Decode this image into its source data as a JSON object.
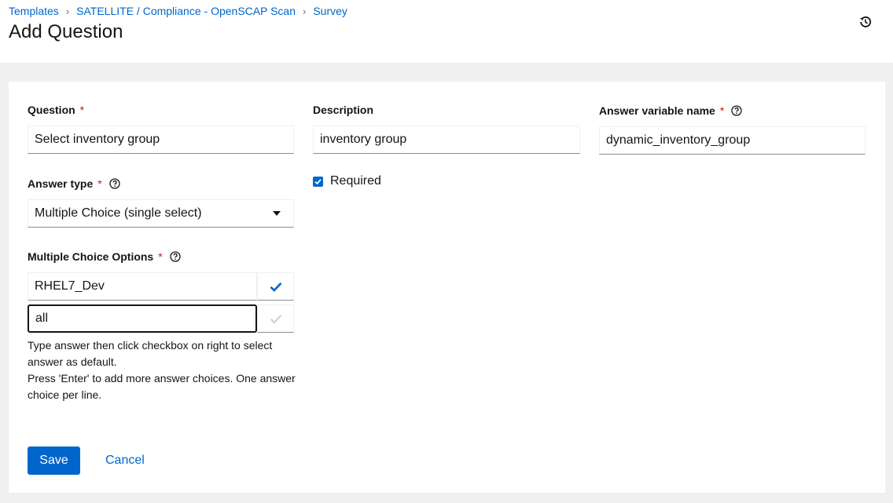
{
  "breadcrumb": {
    "items": [
      "Templates",
      "SATELLITE / Compliance - OpenSCAP Scan",
      "Survey"
    ],
    "separator": "›"
  },
  "page": {
    "title": "Add Question"
  },
  "form": {
    "question": {
      "label": "Question",
      "required_mark": "*",
      "value": "Select inventory group"
    },
    "description": {
      "label": "Description",
      "value": "inventory group"
    },
    "variable": {
      "label": "Answer variable name",
      "required_mark": "*",
      "value": "dynamic_inventory_group"
    },
    "answer_type": {
      "label": "Answer type",
      "required_mark": "*",
      "value": "Multiple Choice (single select)"
    },
    "required": {
      "label": "Required",
      "checked": true
    },
    "choices": {
      "label": "Multiple Choice Options",
      "required_mark": "*",
      "options": [
        {
          "value": "RHEL7_Dev",
          "default": true
        },
        {
          "value": "all",
          "default": false
        }
      ],
      "helper": [
        "Type answer then click checkbox on right to select answer as default.",
        "Press 'Enter' to add more answer choices. One answer choice per line."
      ]
    }
  },
  "actions": {
    "save": "Save",
    "cancel": "Cancel"
  },
  "colors": {
    "primary": "#0066cc",
    "required": "#c9190b",
    "page_bg": "#f0f0f0"
  }
}
